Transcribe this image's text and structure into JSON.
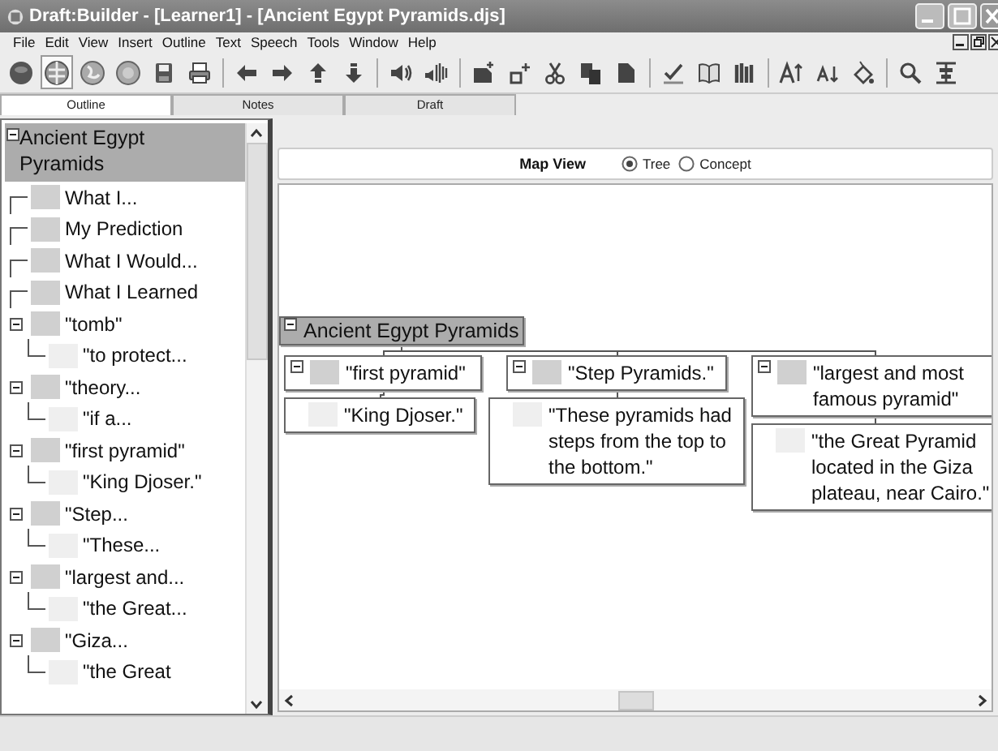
{
  "window": {
    "title": "Draft:Builder - [Learner1] - [Ancient Egypt Pyramids.djs]"
  },
  "menu": [
    "File",
    "Edit",
    "View",
    "Insert",
    "Outline",
    "Text",
    "Speech",
    "Tools",
    "Window",
    "Help"
  ],
  "tabs": [
    {
      "label": "Outline",
      "selected": true
    },
    {
      "label": "Notes",
      "selected": false
    },
    {
      "label": "Draft",
      "selected": false
    }
  ],
  "outline": {
    "root": {
      "label": "Ancient Egypt Pyramids",
      "selected": true,
      "expanded": true
    },
    "items": [
      {
        "label": "What I...",
        "kind": "topic"
      },
      {
        "label": "My Prediction",
        "kind": "topic"
      },
      {
        "label": "What I Would...",
        "kind": "topic"
      },
      {
        "label": "What I Learned",
        "kind": "topic"
      },
      {
        "label": "\"tomb\"",
        "kind": "topic",
        "expanded": true,
        "children": [
          {
            "label": "\"to protect...",
            "kind": "detail"
          }
        ]
      },
      {
        "label": "\"theory...",
        "kind": "topic",
        "expanded": true,
        "children": [
          {
            "label": "\"if a...",
            "kind": "detail"
          }
        ]
      },
      {
        "label": "\"first pyramid\"",
        "kind": "topic",
        "expanded": true,
        "children": [
          {
            "label": "\"King Djoser.\"",
            "kind": "detail"
          }
        ]
      },
      {
        "label": "\"Step...",
        "kind": "topic",
        "expanded": true,
        "children": [
          {
            "label": "\"These...",
            "kind": "detail"
          }
        ]
      },
      {
        "label": "\"largest and...",
        "kind": "topic",
        "expanded": true,
        "children": [
          {
            "label": "\"the Great...",
            "kind": "detail"
          }
        ]
      },
      {
        "label": "\"Giza...",
        "kind": "topic",
        "expanded": true,
        "children": [
          {
            "label": "\"the Great",
            "kind": "detail"
          }
        ]
      }
    ]
  },
  "map_view": {
    "title": "Map View",
    "modes": [
      {
        "label": "Tree",
        "selected": true
      },
      {
        "label": "Concept",
        "selected": false
      }
    ],
    "root": {
      "label": "Ancient Egypt Pyramids",
      "selected": true,
      "expanded": true,
      "children": [
        {
          "label": "\"first pyramid\"",
          "kind": "topic",
          "expanded": true,
          "children": [
            {
              "label": "\"King Djoser.\"",
              "kind": "detail"
            }
          ]
        },
        {
          "label": "\"Step Pyramids.\"",
          "kind": "topic",
          "expanded": true,
          "children": [
            {
              "label": "\"These pyramids had steps from the top to the bottom.\"",
              "kind": "detail"
            }
          ]
        },
        {
          "label": "\"largest and most famous pyramid\"",
          "kind": "topic",
          "expanded": true,
          "children": [
            {
              "label": "\"the Great Pyramid located in the Giza plateau, near Cairo.\"",
              "kind": "detail"
            }
          ]
        }
      ]
    }
  }
}
